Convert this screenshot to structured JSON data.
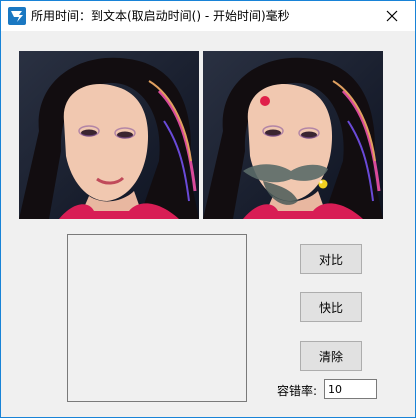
{
  "window": {
    "title": "所用时间：到文本(取启动时间() - 开始时间)毫秒",
    "icon": "app-logo-icon",
    "close_icon": "close-icon"
  },
  "images": {
    "original_photo": "portrait-original",
    "modified_photo": "portrait-modified"
  },
  "buttons": {
    "compare": "对比",
    "fast_compare": "快比",
    "clear": "清除"
  },
  "tolerance": {
    "label": "容错率:",
    "value": "10"
  },
  "colors": {
    "window_border": "#1883d7",
    "client_bg": "#f0f0f0",
    "button_bg": "#e1e1e1",
    "button_border": "#adadad"
  }
}
